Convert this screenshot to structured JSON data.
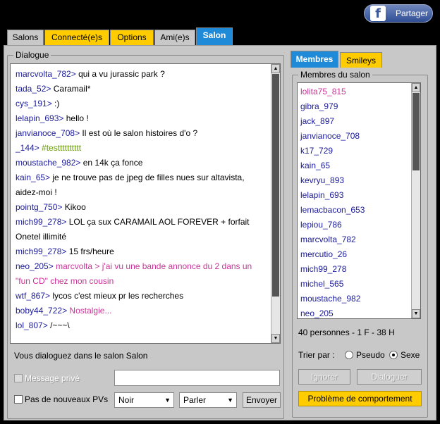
{
  "share": {
    "label": "Partager",
    "icon": "facebook-icon",
    "logo_letter": "f"
  },
  "tabs": [
    {
      "label": "Salons"
    },
    {
      "label": "Connecté(e)s"
    },
    {
      "label": "Options"
    },
    {
      "label": "Ami(e)s"
    },
    {
      "label": "Salon"
    }
  ],
  "dialogue": {
    "legend": "Dialogue",
    "lines": [
      {
        "nick": "marcvolta_782>",
        "text": "qui a vu jurassic park ?",
        "color": "#000000"
      },
      {
        "nick": "tada_52>",
        "text": "Caramail*",
        "color": "#000000"
      },
      {
        "nick": "cys_191>",
        "text": ":)",
        "color": "#000000"
      },
      {
        "nick": "lelapin_693>",
        "text": "hello !",
        "color": "#000000"
      },
      {
        "nick": "janvianoce_708>",
        "text": "Il est où  le salon histoires d'o ?",
        "color": "#000000"
      },
      {
        "nick": "_144>",
        "text": "#testttttttttt",
        "color": "#669900"
      },
      {
        "nick": "moustache_982>",
        "text": "en 14k ça fonce",
        "color": "#000000"
      },
      {
        "nick": "kain_65>",
        "text": "je ne trouve pas de jpeg de filles nues sur altavista,",
        "color": "#000000"
      },
      {
        "nick": "",
        "text": "aidez-moi !",
        "color": "#000000"
      },
      {
        "nick": "pointg_750>",
        "text": "Kikoo",
        "color": "#000000"
      },
      {
        "nick": "mich99_278>",
        "text": "LOL ça sux CARAMAIL AOL FOREVER + forfait",
        "color": "#000000"
      },
      {
        "nick": "",
        "text": "Onetel illimité",
        "color": "#000000"
      },
      {
        "nick": "mich99_278>",
        "text": "15 frs/heure",
        "color": "#000000"
      },
      {
        "nick": "neo_205>",
        "text": "marcvolta > j'ai vu une bande annonce du 2 dans un",
        "color": "#cc3399"
      },
      {
        "nick": "",
        "text": "\"fun CD\" chez mon cousin",
        "color": "#cc3399"
      },
      {
        "nick": "wtf_867>",
        "text": "lycos c'est mieux pr les recherches",
        "color": "#000000"
      },
      {
        "nick": "boby44_722>",
        "text": "Nostalgie...",
        "color": "#cc3399"
      },
      {
        "nick": "lol_807>",
        "text": "/~~~\\",
        "color": "#000000"
      }
    ],
    "status": "Vous dialoguez dans le salon Salon"
  },
  "compose": {
    "private_label": "Message privé",
    "no_pv_label": "Pas de nouveaux PVs",
    "message_value": "",
    "color_select": "Noir",
    "mode_select": "Parler",
    "send_label": "Envoyer"
  },
  "side_tabs": [
    {
      "label": "Membres"
    },
    {
      "label": "Smileys"
    }
  ],
  "members": {
    "legend": "Membres du salon",
    "list": [
      {
        "name": "lolita75_815",
        "color": "#cc3399"
      },
      {
        "name": "gibra_979",
        "color": "#1a1a9a"
      },
      {
        "name": "jack_897",
        "color": "#1a1a9a"
      },
      {
        "name": "janvianoce_708",
        "color": "#1a1a9a"
      },
      {
        "name": "k17_729",
        "color": "#1a1a9a"
      },
      {
        "name": "kain_65",
        "color": "#1a1a9a"
      },
      {
        "name": "kevryu_893",
        "color": "#1a1a9a"
      },
      {
        "name": "lelapin_693",
        "color": "#1a1a9a"
      },
      {
        "name": "lemacbacon_653",
        "color": "#1a1a9a"
      },
      {
        "name": "lepiou_786",
        "color": "#1a1a9a"
      },
      {
        "name": "marcvolta_782",
        "color": "#1a1a9a"
      },
      {
        "name": "mercutio_26",
        "color": "#1a1a9a"
      },
      {
        "name": "mich99_278",
        "color": "#1a1a9a"
      },
      {
        "name": "michel_565",
        "color": "#1a1a9a"
      },
      {
        "name": "moustache_982",
        "color": "#1a1a9a"
      },
      {
        "name": "neo_205",
        "color": "#1a1a9a"
      }
    ],
    "count_text": "40 personnes - 1 F - 38 H",
    "sort_label": "Trier par :",
    "sort_pseudo": "Pseudo",
    "sort_sexe": "Sexe",
    "ignore_label": "Ignorer",
    "dialogue_label": "Dialoguer",
    "report_label": "Problème de comportement"
  }
}
